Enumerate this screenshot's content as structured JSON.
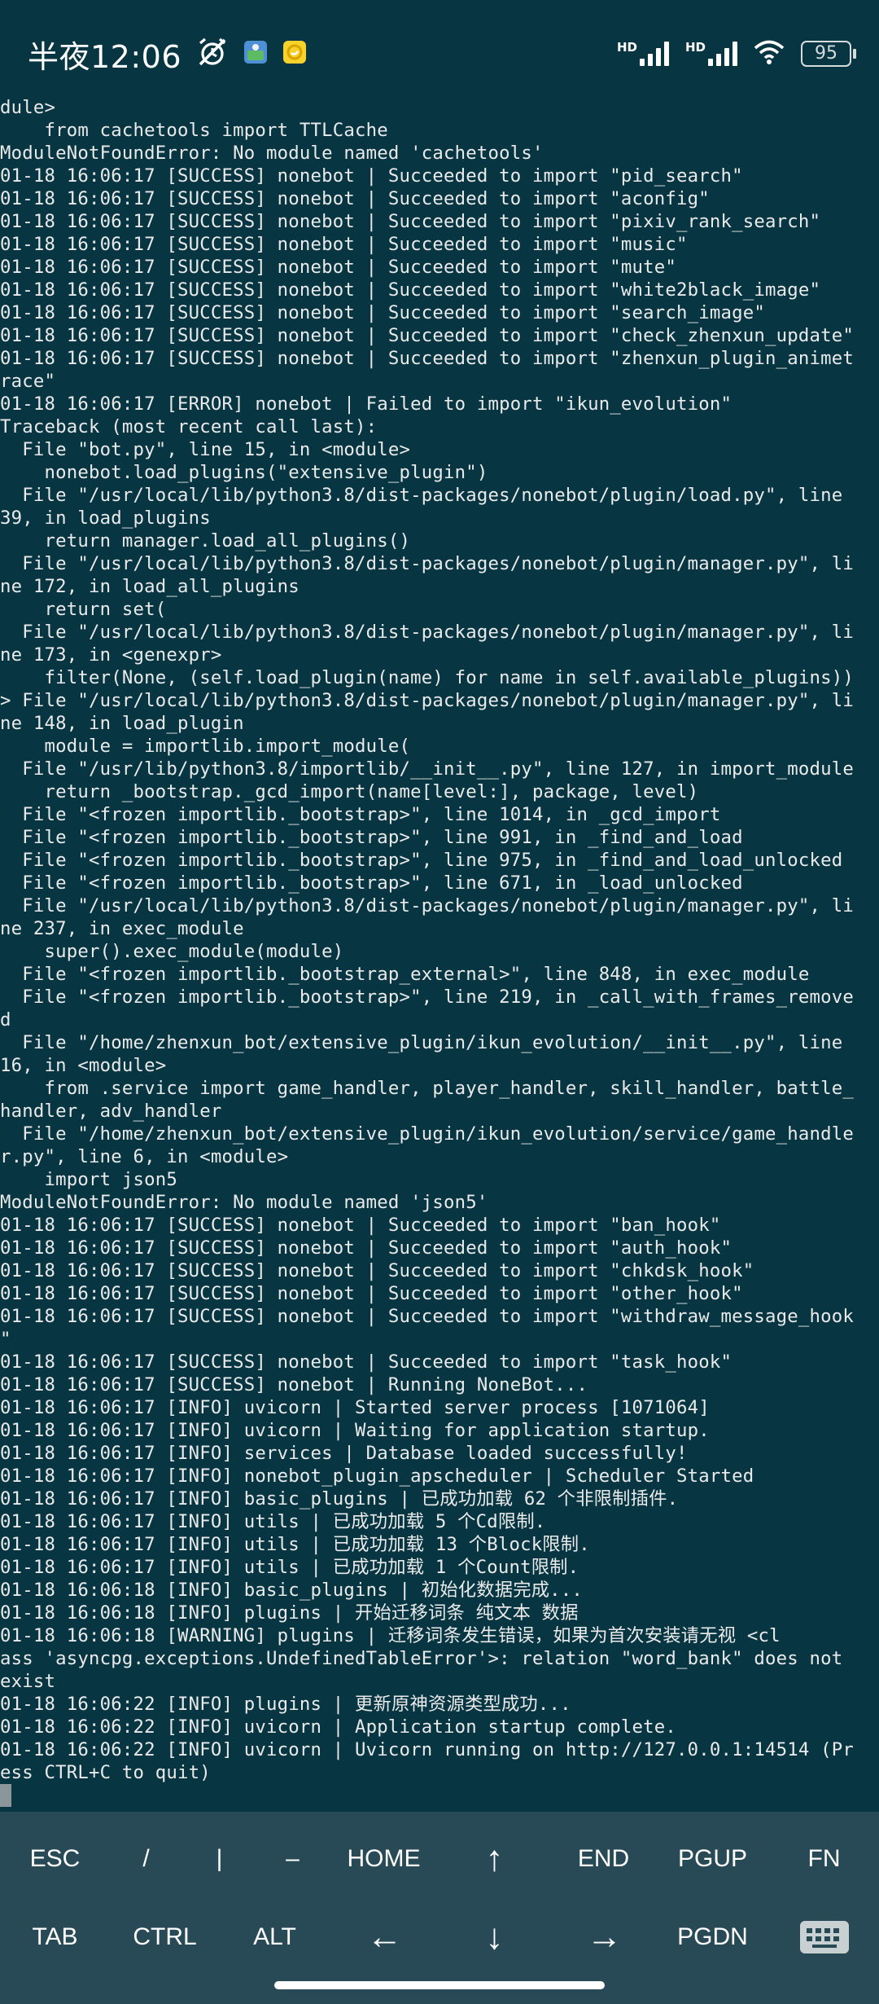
{
  "status_bar": {
    "time": "半夜12:06",
    "sim1_label": "HD",
    "sim2_label": "HD",
    "battery": "95",
    "icons": [
      "alarm-off-icon",
      "image-icon",
      "app-notification-icon",
      "signal-icon",
      "wifi-icon",
      "battery-icon"
    ]
  },
  "terminal": {
    "lines": [
      "dule>",
      "    from cachetools import TTLCache",
      "ModuleNotFoundError: No module named 'cachetools'",
      "01-18 16:06:17 [SUCCESS] nonebot | Succeeded to import \"pid_search\"",
      "01-18 16:06:17 [SUCCESS] nonebot | Succeeded to import \"aconfig\"",
      "01-18 16:06:17 [SUCCESS] nonebot | Succeeded to import \"pixiv_rank_search\"",
      "01-18 16:06:17 [SUCCESS] nonebot | Succeeded to import \"music\"",
      "01-18 16:06:17 [SUCCESS] nonebot | Succeeded to import \"mute\"",
      "01-18 16:06:17 [SUCCESS] nonebot | Succeeded to import \"white2black_image\"",
      "01-18 16:06:17 [SUCCESS] nonebot | Succeeded to import \"search_image\"",
      "01-18 16:06:17 [SUCCESS] nonebot | Succeeded to import \"check_zhenxun_update\"",
      "01-18 16:06:17 [SUCCESS] nonebot | Succeeded to import \"zhenxun_plugin_animet",
      "race\"",
      "01-18 16:06:17 [ERROR] nonebot | Failed to import \"ikun_evolution\"",
      "Traceback (most recent call last):",
      "  File \"bot.py\", line 15, in <module>",
      "    nonebot.load_plugins(\"extensive_plugin\")",
      "  File \"/usr/local/lib/python3.8/dist-packages/nonebot/plugin/load.py\", line",
      "39, in load_plugins",
      "    return manager.load_all_plugins()",
      "  File \"/usr/local/lib/python3.8/dist-packages/nonebot/plugin/manager.py\", li",
      "ne 172, in load_all_plugins",
      "    return set(",
      "  File \"/usr/local/lib/python3.8/dist-packages/nonebot/plugin/manager.py\", li",
      "ne 173, in <genexpr>",
      "    filter(None, (self.load_plugin(name) for name in self.available_plugins))",
      "> File \"/usr/local/lib/python3.8/dist-packages/nonebot/plugin/manager.py\", li",
      "ne 148, in load_plugin",
      "    module = importlib.import_module(",
      "  File \"/usr/lib/python3.8/importlib/__init__.py\", line 127, in import_module",
      "    return _bootstrap._gcd_import(name[level:], package, level)",
      "  File \"<frozen importlib._bootstrap>\", line 1014, in _gcd_import",
      "  File \"<frozen importlib._bootstrap>\", line 991, in _find_and_load",
      "  File \"<frozen importlib._bootstrap>\", line 975, in _find_and_load_unlocked",
      "  File \"<frozen importlib._bootstrap>\", line 671, in _load_unlocked",
      "  File \"/usr/local/lib/python3.8/dist-packages/nonebot/plugin/manager.py\", li",
      "ne 237, in exec_module",
      "    super().exec_module(module)",
      "  File \"<frozen importlib._bootstrap_external>\", line 848, in exec_module",
      "  File \"<frozen importlib._bootstrap>\", line 219, in _call_with_frames_remove",
      "d",
      "  File \"/home/zhenxun_bot/extensive_plugin/ikun_evolution/__init__.py\", line",
      "16, in <module>",
      "    from .service import game_handler, player_handler, skill_handler, battle_",
      "handler, adv_handler",
      "  File \"/home/zhenxun_bot/extensive_plugin/ikun_evolution/service/game_handle",
      "r.py\", line 6, in <module>",
      "    import json5",
      "ModuleNotFoundError: No module named 'json5'",
      "01-18 16:06:17 [SUCCESS] nonebot | Succeeded to import \"ban_hook\"",
      "01-18 16:06:17 [SUCCESS] nonebot | Succeeded to import \"auth_hook\"",
      "01-18 16:06:17 [SUCCESS] nonebot | Succeeded to import \"chkdsk_hook\"",
      "01-18 16:06:17 [SUCCESS] nonebot | Succeeded to import \"other_hook\"",
      "01-18 16:06:17 [SUCCESS] nonebot | Succeeded to import \"withdraw_message_hook",
      "\"",
      "01-18 16:06:17 [SUCCESS] nonebot | Succeeded to import \"task_hook\"",
      "01-18 16:06:17 [SUCCESS] nonebot | Running NoneBot...",
      "01-18 16:06:17 [INFO] uvicorn | Started server process [1071064]",
      "01-18 16:06:17 [INFO] uvicorn | Waiting for application startup.",
      "01-18 16:06:17 [INFO] services | Database loaded successfully!",
      "01-18 16:06:17 [INFO] nonebot_plugin_apscheduler | Scheduler Started",
      "01-18 16:06:17 [INFO] basic_plugins | 已成功加载 62 个非限制插件.",
      "01-18 16:06:17 [INFO] utils | 已成功加载 5 个Cd限制.",
      "01-18 16:06:17 [INFO] utils | 已成功加载 13 个Block限制.",
      "01-18 16:06:17 [INFO] utils | 已成功加载 1 个Count限制.",
      "01-18 16:06:18 [INFO] basic_plugins | 初始化数据完成...",
      "01-18 16:06:18 [INFO] plugins | 开始迁移词条 纯文本 数据",
      "01-18 16:06:18 [WARNING] plugins | 迁移词条发生错误，如果为首次安装请无视 <cl",
      "ass 'asyncpg.exceptions.UndefinedTableError'>: relation \"word_bank\" does not",
      "exist",
      "01-18 16:06:22 [INFO] plugins | 更新原神资源类型成功...",
      "01-18 16:06:22 [INFO] uvicorn | Application startup complete.",
      "01-18 16:06:22 [INFO] uvicorn | Uvicorn running on http://127.0.0.1:14514 (Pr",
      "ess CTRL+C to quit)"
    ]
  },
  "extra_keys": {
    "row1": [
      "ESC",
      "/",
      "|",
      "–",
      "HOME",
      "↑",
      "END",
      "PGUP",
      "FN"
    ],
    "row2": [
      "TAB",
      "CTRL",
      "ALT",
      "←",
      "↓",
      "→",
      "PGDN"
    ],
    "keyboard_icon": "keyboard-icon"
  }
}
